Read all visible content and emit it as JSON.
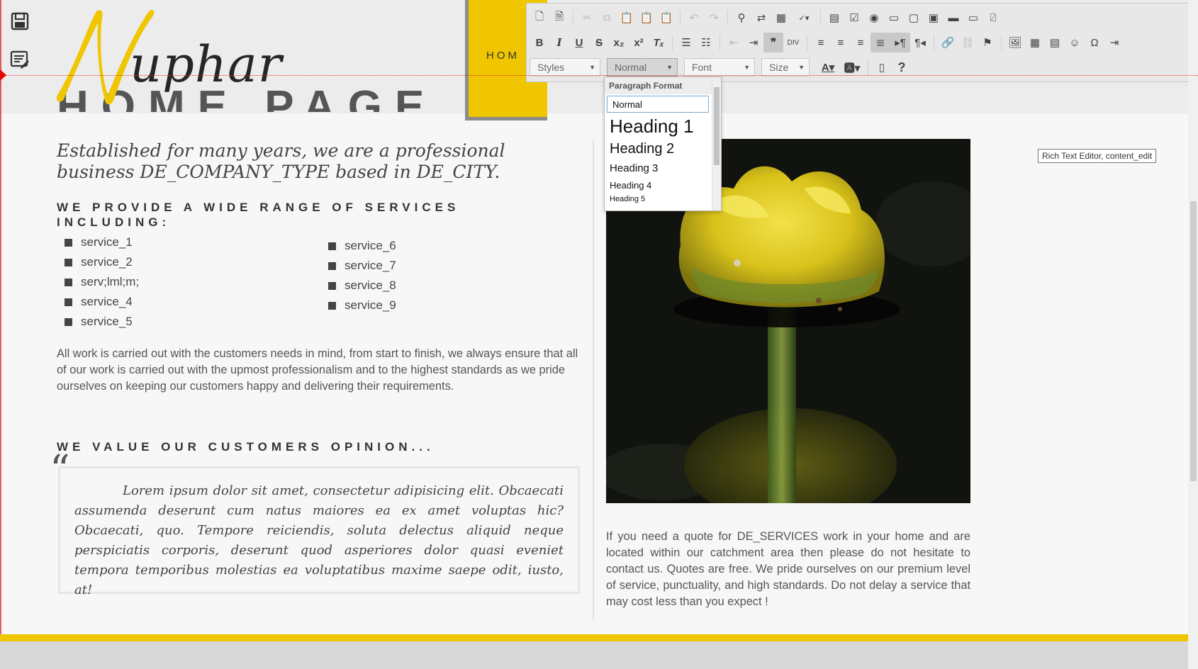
{
  "brand": {
    "logo_text": "uphar",
    "logo_initial": "N"
  },
  "header": {
    "nav_home": "HOM",
    "hero_ghost": "HOME PAGE"
  },
  "toolbar": {
    "styles_label": "Styles",
    "format_label": "Normal",
    "font_label": "Font",
    "size_label": "Size",
    "bold": "B",
    "italic": "I",
    "underline": "U",
    "strike": "S",
    "help": "?"
  },
  "format_dropdown": {
    "title": "Paragraph Format",
    "items": [
      "Normal",
      "Heading 1",
      "Heading 2",
      "Heading 3",
      "Heading 4",
      "Heading 5"
    ]
  },
  "tooltip": "Rich Text Editor, content_edit",
  "intro": "Established for many years, we are a professional business DE_COMPANY_TYPE based in DE_CITY.",
  "services": {
    "heading": "WE PROVIDE A WIDE RANGE OF SERVICES INCLUDING:",
    "col1": [
      "service_1",
      "service_2",
      "serv;lml;m;",
      "service_4",
      "service_5"
    ],
    "col2": [
      "service_6",
      "service_7",
      "service_8",
      "service_9"
    ]
  },
  "work_paragraph": "All work is carried out with the customers needs in mind, from start to finish, we always ensure that all of our work is carried out with the upmost professionalism and to the highest standards as we pride ourselves on keeping our customers happy and delivering their requirements.",
  "testimonial": {
    "heading": "WE VALUE OUR CUSTOMERS OPINION...",
    "quote_mark": "“",
    "text": "Lorem ipsum dolor sit amet, consectetur adipisicing elit. Obcaecati assumenda deserunt cum natus maiores ea ex amet voluptas hic? Obcaecati, quo. Tempore reiciendis, soluta delectus aliquid neque perspiciatis corporis, deserunt quod asperiores dolor quasi eveniet tempora temporibus molestias ea voluptatibus maxime saepe odit, iusto, at!"
  },
  "quote_paragraph": "If you need a quote for DE_SERVICES work in your home and are located within our catchment area then please do not hesitate to contact us. Quotes are free. We pride ourselves on our premium level of service, punctuality, and high standards. Do not delay a service that may cost less than you expect !",
  "colors": {
    "accent": "#efc600",
    "guide": "#e03030",
    "text": "#444444"
  },
  "icons": {
    "save": "save-icon",
    "page_list": "page-list-icon"
  }
}
